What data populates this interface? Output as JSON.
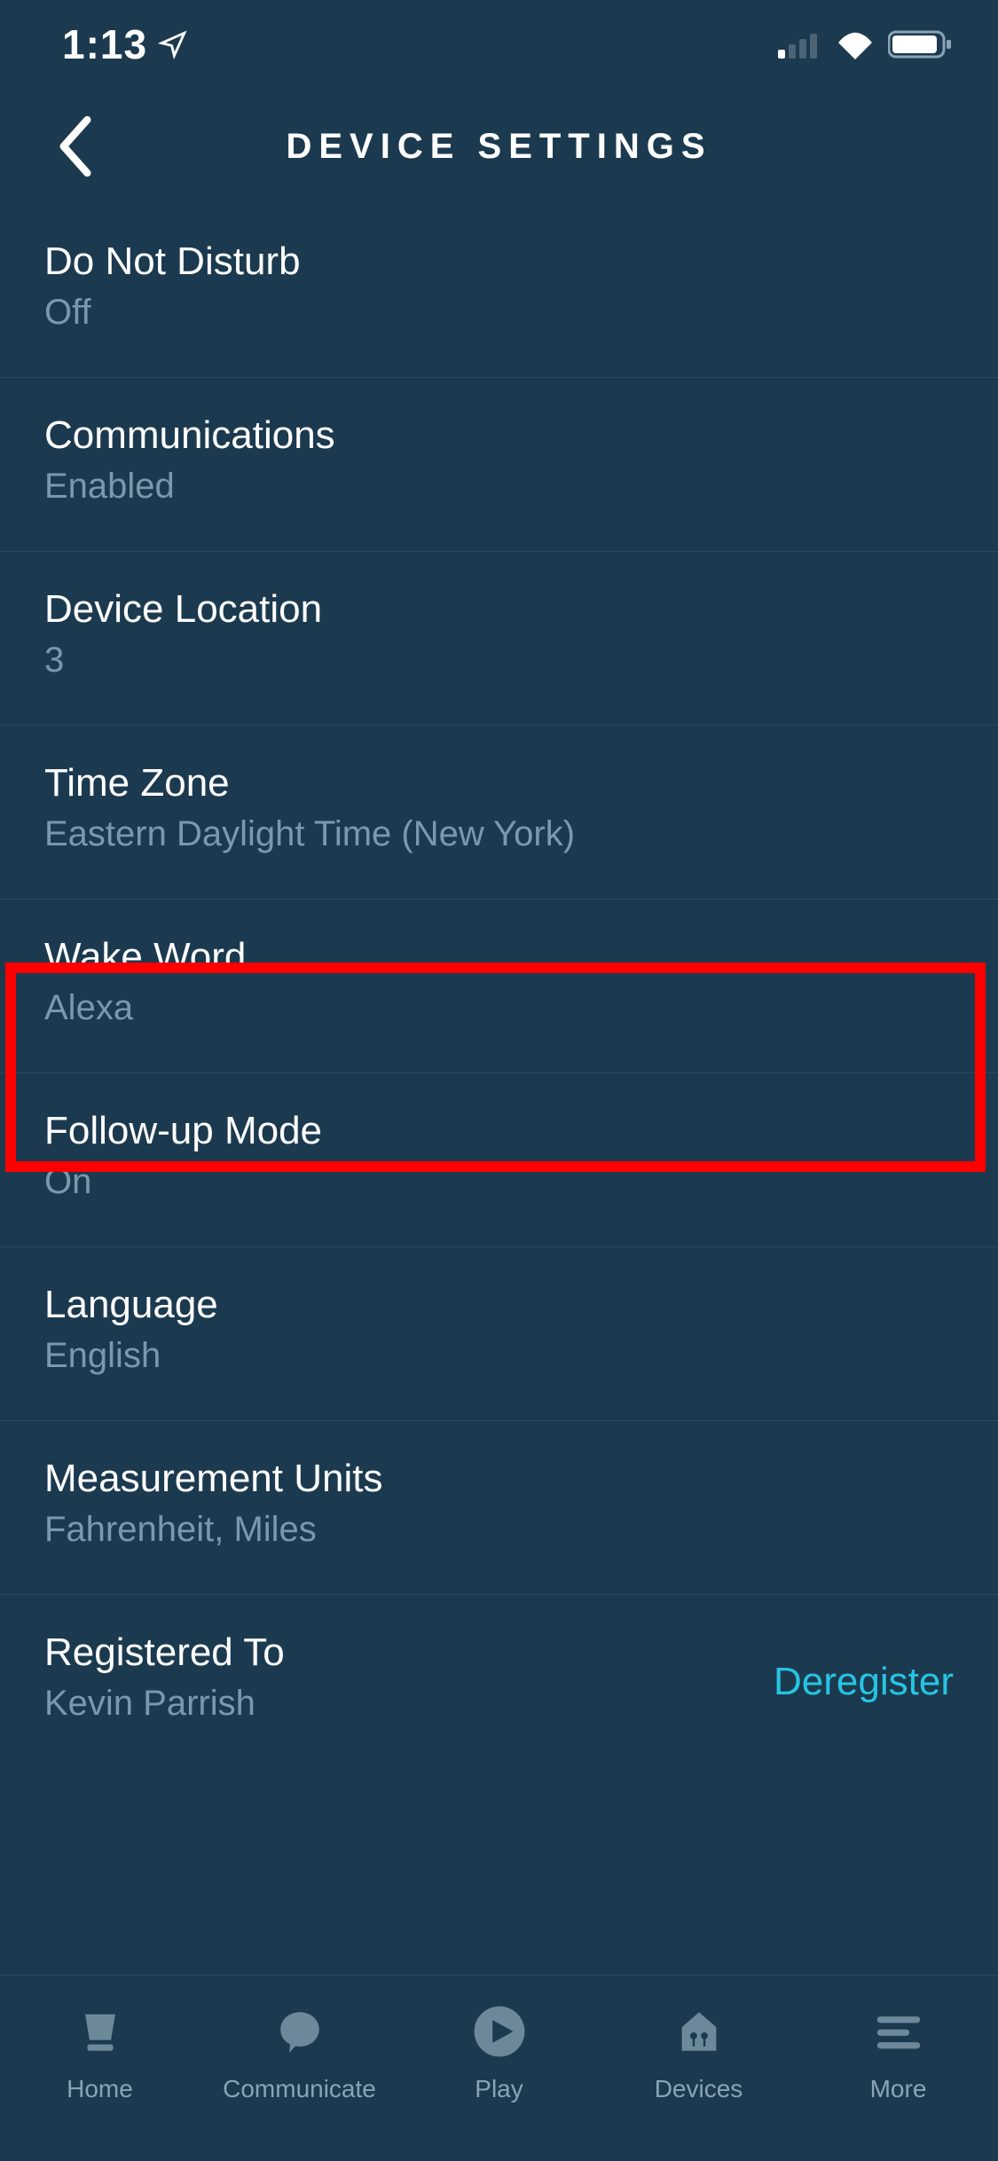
{
  "status_bar": {
    "time": "1:13"
  },
  "header": {
    "title": "DEVICE SETTINGS"
  },
  "settings": [
    {
      "label": "Do Not Disturb",
      "value": "Off"
    },
    {
      "label": "Communications",
      "value": "Enabled"
    },
    {
      "label": "Device Location",
      "value": "3"
    },
    {
      "label": "Time Zone",
      "value": "Eastern Daylight Time (New York)"
    },
    {
      "label": "Wake Word",
      "value": "Alexa"
    },
    {
      "label": "Follow-up Mode",
      "value": "On"
    },
    {
      "label": "Language",
      "value": "English"
    },
    {
      "label": "Measurement Units",
      "value": "Fahrenheit, Miles"
    },
    {
      "label": "Registered To",
      "value": "Kevin Parrish",
      "action": "Deregister"
    }
  ],
  "nav": [
    {
      "label": "Home"
    },
    {
      "label": "Communicate"
    },
    {
      "label": "Play"
    },
    {
      "label": "Devices"
    },
    {
      "label": "More"
    }
  ],
  "highlighted_index": 4
}
